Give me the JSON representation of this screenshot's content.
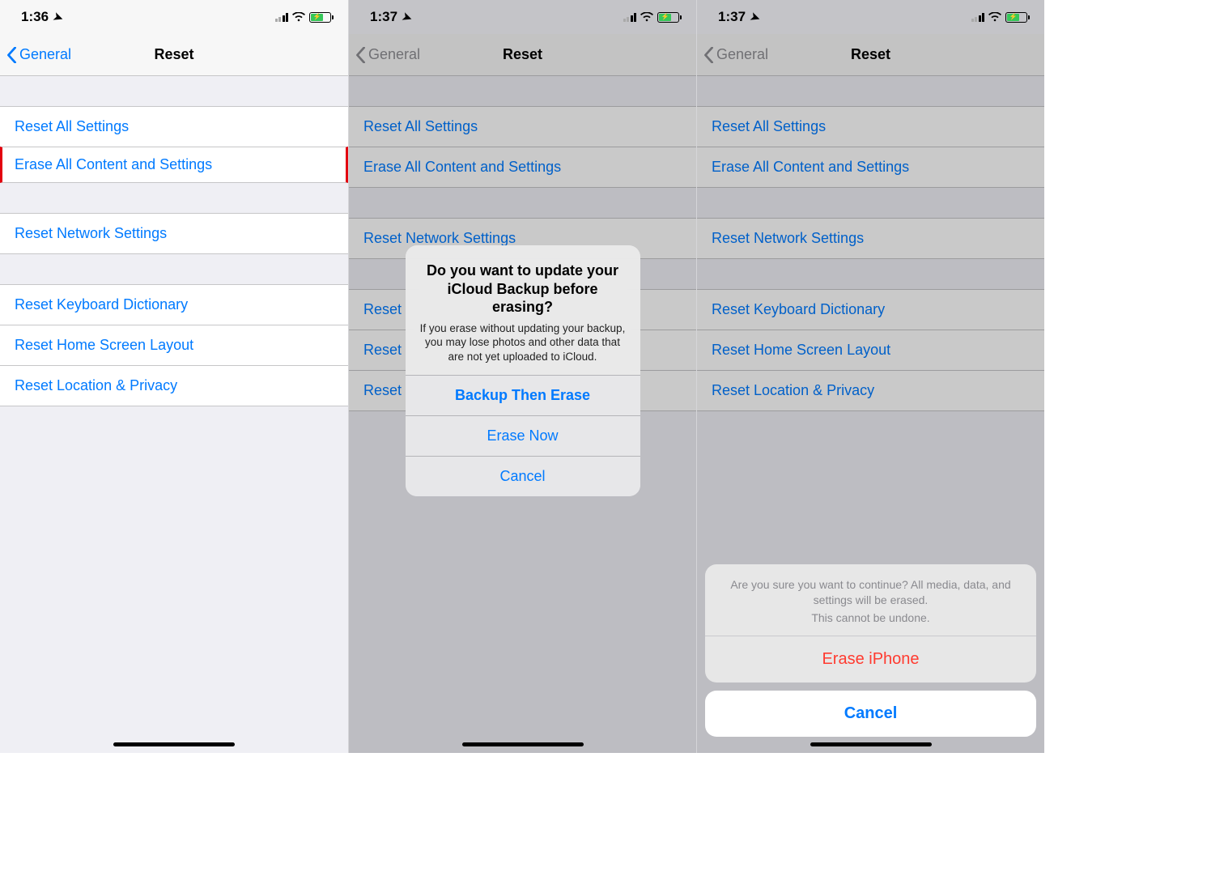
{
  "screen1": {
    "time": "1:36",
    "back_label": "General",
    "title": "Reset",
    "rows": {
      "g1r1": "Reset All Settings",
      "g1r2": "Erase All Content and Settings",
      "g2r1": "Reset Network Settings",
      "g3r1": "Reset Keyboard Dictionary",
      "g3r2": "Reset Home Screen Layout",
      "g3r3": "Reset Location & Privacy"
    }
  },
  "screen2": {
    "time": "1:37",
    "back_label": "General",
    "title": "Reset",
    "rows": {
      "g1r1": "Reset All Settings",
      "g1r2": "Erase All Content and Settings",
      "g2r1": "Reset Network Settings",
      "g3r1": "Reset",
      "g3r2": "Reset",
      "g3r3": "Reset"
    },
    "alert": {
      "title": "Do you want to update your iCloud Backup before erasing?",
      "message": "If you erase without updating your backup, you may lose photos and other data that are not yet uploaded to iCloud.",
      "btn1": "Backup Then Erase",
      "btn2": "Erase Now",
      "btn3": "Cancel"
    }
  },
  "screen3": {
    "time": "1:37",
    "back_label": "General",
    "title": "Reset",
    "rows": {
      "g1r1": "Reset All Settings",
      "g1r2": "Erase All Content and Settings",
      "g2r1": "Reset Network Settings",
      "g3r1": "Reset Keyboard Dictionary",
      "g3r2": "Reset Home Screen Layout",
      "g3r3": "Reset Location & Privacy"
    },
    "sheet": {
      "msg1": "Are you sure you want to continue? All media, data, and settings will be erased.",
      "msg2": "This cannot be undone.",
      "erase": "Erase iPhone",
      "cancel": "Cancel"
    }
  }
}
